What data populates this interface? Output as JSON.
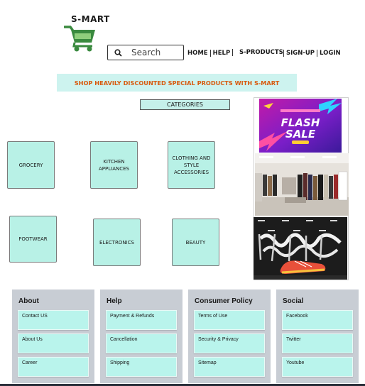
{
  "header": {
    "logo_text": "S-MART",
    "search_placeholder": "Search"
  },
  "nav": {
    "home": "HOME",
    "help": "HELP",
    "s_products": "S-PRODUCTS",
    "sign_up": "SIGN-UP",
    "login": "LOGIN"
  },
  "banner": {
    "text": "SHOP HEAVILY DISCOUNTED SPECIAL PRODUCTS WITH S-MART"
  },
  "categories": {
    "heading": "CATEGORIES",
    "items": [
      "GROCERY",
      "KITCHEN APPLIANCES",
      "CLOTHING AND STYLE ACCESSORIES",
      "FOOTWEAR",
      "ELECTRONICS",
      "BEAUTY"
    ]
  },
  "promo": {
    "flash_line1": "FLASH",
    "flash_line2": "SALE"
  },
  "footer": {
    "columns": [
      {
        "title": "About",
        "items": [
          "Contact US",
          "About Us",
          "Career"
        ]
      },
      {
        "title": "Help",
        "items": [
          "Payment & Refunds",
          "Cancellation",
          "Shipping"
        ]
      },
      {
        "title": "Consumer Policy",
        "items": [
          "Terms of Use",
          "Security & Privacy",
          "Sitemap"
        ]
      },
      {
        "title": "Social",
        "items": [
          "Facebook",
          "Twitter",
          "Youtube"
        ]
      }
    ]
  },
  "colors": {
    "accent_mint": "#b8f1e6",
    "banner_text": "#d85a0e",
    "cart_green": "#3a8a3f",
    "footer_bg": "#c8cdd4"
  }
}
